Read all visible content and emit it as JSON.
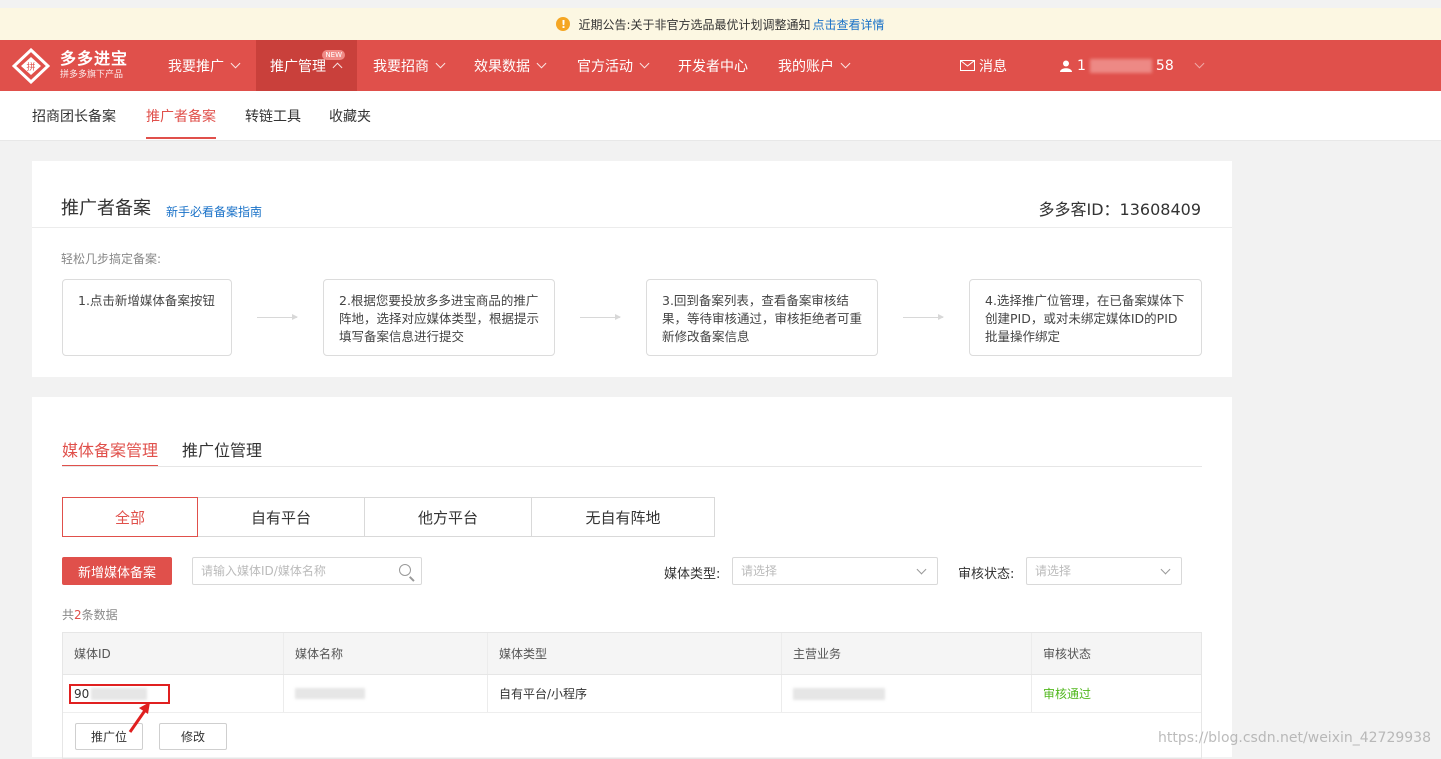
{
  "notice": {
    "text": "近期公告:关于非官方选品最优计划调整通知",
    "link": "点击查看详情"
  },
  "header": {
    "logo_title": "多多进宝",
    "logo_sub": "拼多多旗下产品",
    "nav": [
      {
        "label": "我要推广"
      },
      {
        "label": "推广管理",
        "badge": "NEW"
      },
      {
        "label": "我要招商"
      },
      {
        "label": "效果数据"
      },
      {
        "label": "官方活动"
      },
      {
        "label": "开发者中心"
      },
      {
        "label": "我的账户"
      }
    ],
    "messages": "消息",
    "user_prefix": "1",
    "user_suffix": "58"
  },
  "subnav": [
    "招商团长备案",
    "推广者备案",
    "转链工具",
    "收藏夹"
  ],
  "guide_card": {
    "title": "推广者备案",
    "guide_link": "新手必看备案指南",
    "duoduo_id": "多多客ID：13608409",
    "steps_label": "轻松几步搞定备案:",
    "steps": [
      "1.点击新增媒体备案按钮",
      "2.根据您要投放多多进宝商品的推广阵地，选择对应媒体类型，根据提示填写备案信息进行提交",
      "3.回到备案列表，查看备案审核结果，等待审核通过，审核拒绝者可重新修改备案信息",
      "4.选择推广位管理，在已备案媒体下创建PID，或对未绑定媒体ID的PID批量操作绑定"
    ]
  },
  "media_card": {
    "tabs": [
      "媒体备案管理",
      "推广位管理"
    ],
    "segments": [
      "全部",
      "自有平台",
      "他方平台",
      "无自有阵地"
    ],
    "add_button": "新增媒体备案",
    "search_placeholder": "请输入媒体ID/媒体名称",
    "media_type_label": "媒体类型:",
    "media_type_placeholder": "请选择",
    "review_status_label": "审核状态:",
    "review_status_placeholder": "请选择",
    "count_prefix": "共",
    "count_num": "2",
    "count_suffix": "条数据",
    "columns": [
      "媒体ID",
      "媒体名称",
      "媒体类型",
      "主营业务",
      "审核状态"
    ],
    "rows": [
      {
        "media_id_prefix": "90",
        "media_type": "自有平台/小程序",
        "status": "审核通过"
      }
    ],
    "row_actions": [
      "推广位",
      "修改"
    ]
  },
  "watermark": "https://blog.csdn.net/weixin_42729938",
  "colors": {
    "brand": "#e0504b",
    "notice_bg": "#fcf7e2",
    "status_ok": "#52b81f",
    "link": "#1a72c8"
  }
}
